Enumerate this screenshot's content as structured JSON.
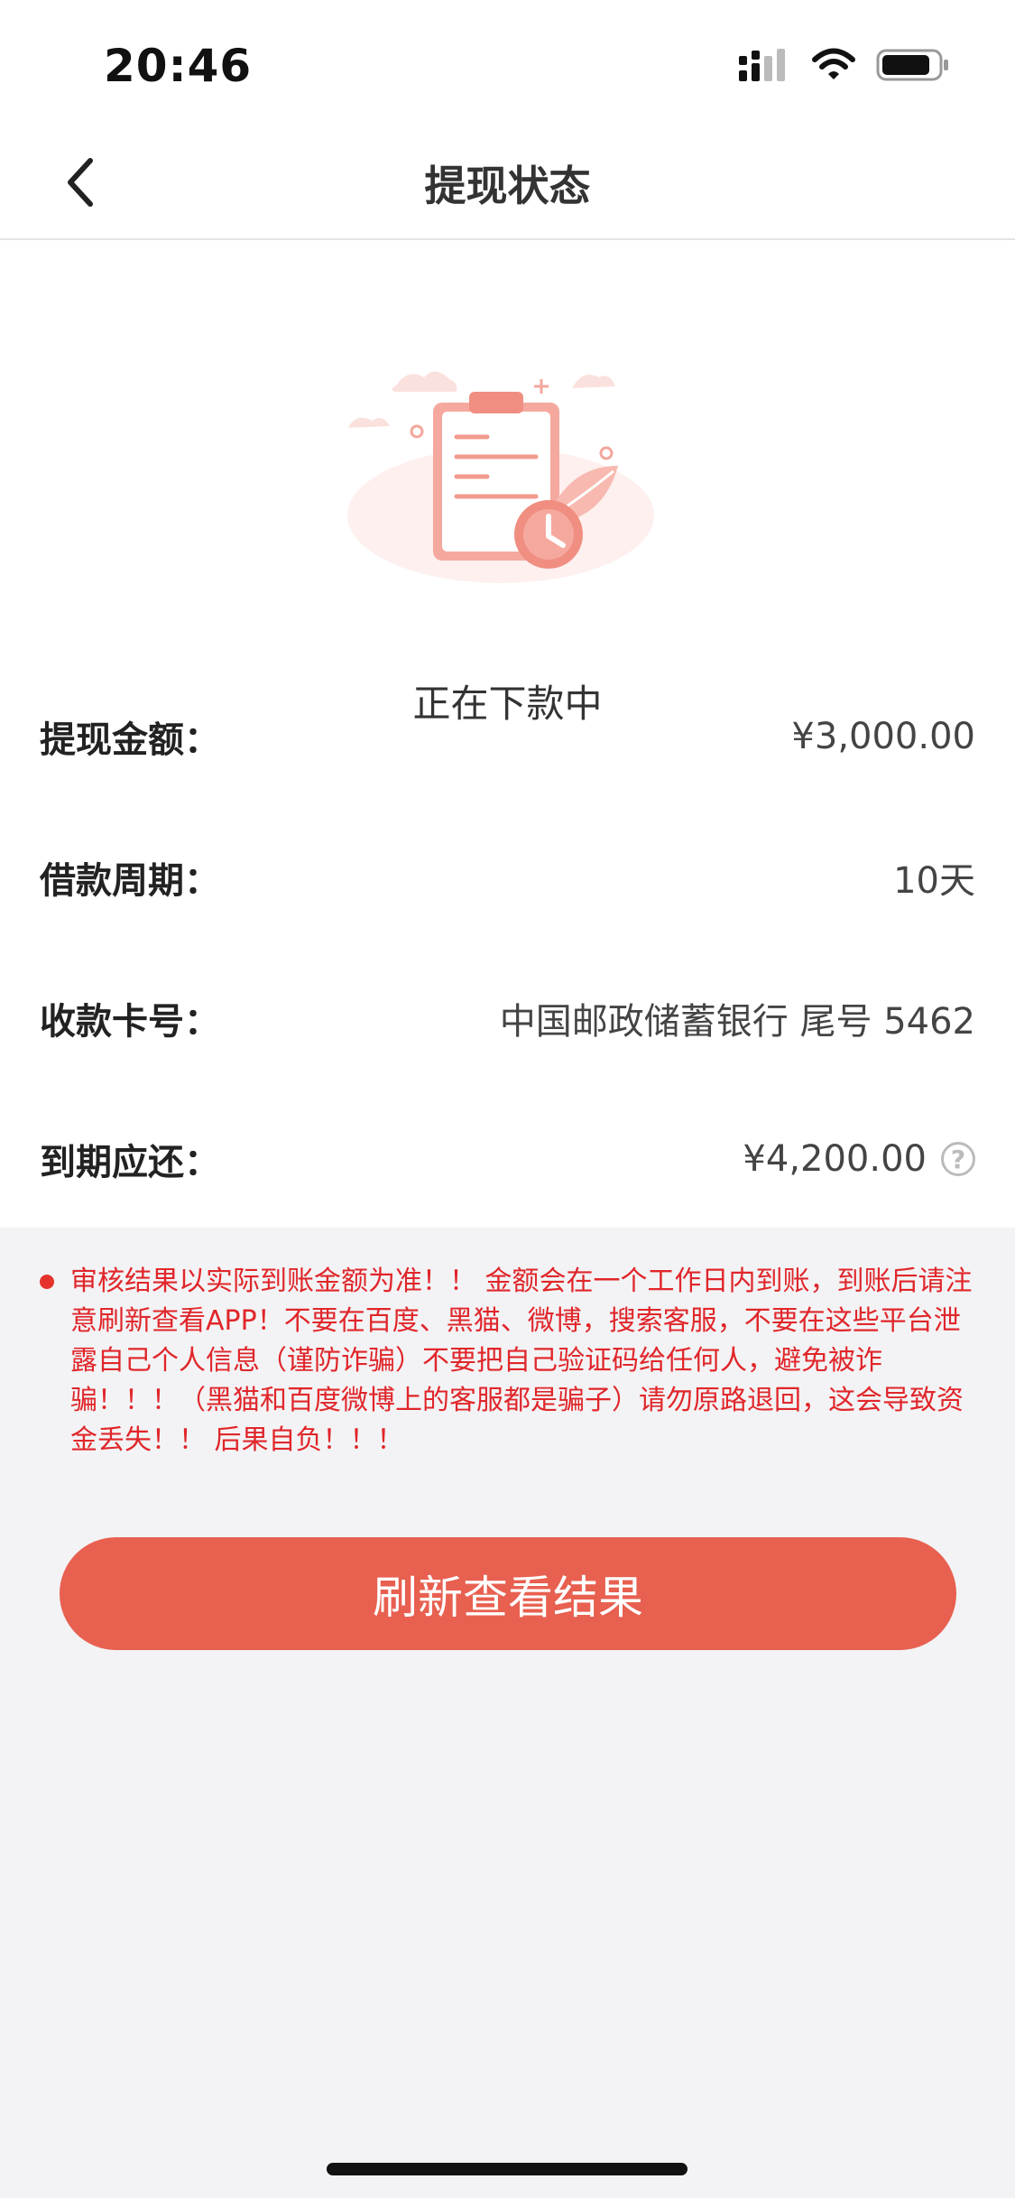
{
  "status_bar": {
    "time": "20:46",
    "icons": [
      "signal-icon",
      "wifi-icon",
      "battery-icon"
    ]
  },
  "nav": {
    "title": "提现状态",
    "back_icon": "chevron-left-icon"
  },
  "status": {
    "illustration_icon": "clipboard-clock-icon",
    "message": "正在下款中"
  },
  "details": [
    {
      "label": "提现金额：",
      "value": "¥3,000.00"
    },
    {
      "label": "借款周期：",
      "value": "10天"
    },
    {
      "label": "收款卡号：",
      "value": "中国邮政储蓄银行 尾号 5462"
    },
    {
      "label": "到期应还：",
      "value": "¥4,200.00",
      "help_icon": "?"
    }
  ],
  "notice": {
    "text": "审核结果以实际到账金额为准！！ 金额会在一个工作日内到账，到账后请注意刷新查看APP！不要在百度、黑猫、微博，搜索客服，不要在这些平台泄露自己个人信息（谨防诈骗）不要把自己验证码给任何人，避免被诈骗！！！（黑猫和百度微博上的客服都是骗子）请勿原路退回，这会导致资金丢失！！ 后果自负！！！"
  },
  "actions": {
    "refresh_label": "刷新查看结果"
  },
  "colors": {
    "accent": "#e86050",
    "warning_text": "#e0262a",
    "background": "#f3f3f5"
  }
}
